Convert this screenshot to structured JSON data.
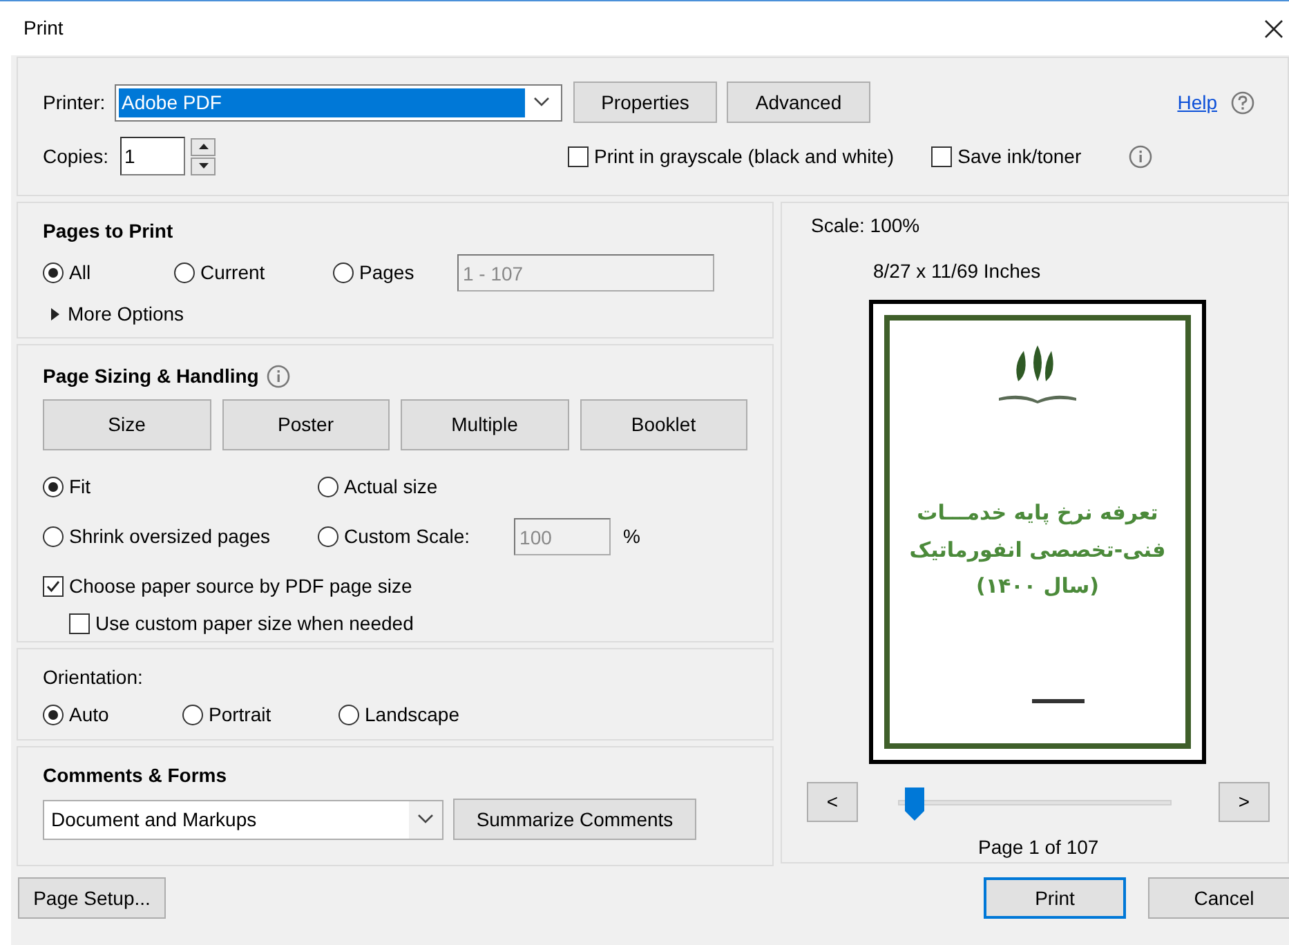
{
  "window": {
    "title": "Print"
  },
  "printer": {
    "label": "Printer:",
    "value": "Adobe PDF",
    "buttons": [
      "Properties",
      "Advanced"
    ]
  },
  "help": {
    "label": "Help"
  },
  "copies": {
    "label": "Copies:",
    "value": "1"
  },
  "top_checkboxes": [
    {
      "label": "Print in grayscale (black and white)",
      "checked": false
    },
    {
      "label": "Save ink/toner",
      "checked": false
    }
  ],
  "pages_to_print": {
    "title": "Pages to Print",
    "options": [
      {
        "label": "All",
        "selected": true
      },
      {
        "label": "Current",
        "selected": false
      },
      {
        "label": "Pages",
        "selected": false
      }
    ],
    "range": {
      "value": "1 - 107"
    },
    "more_options": "More Options"
  },
  "page_sizing": {
    "title": "Page Sizing & Handling",
    "modes": [
      "Size",
      "Poster",
      "Multiple",
      "Booklet"
    ],
    "options": [
      {
        "label": "Fit",
        "selected": true
      },
      {
        "label": "Actual size",
        "selected": false
      },
      {
        "label": "Shrink oversized pages",
        "selected": false
      },
      {
        "label": "Custom Scale:",
        "selected": false
      }
    ],
    "custom_scale": {
      "value": "100",
      "unit": "%"
    },
    "checkboxes": [
      {
        "label": "Choose paper source by PDF page size",
        "checked": true,
        "children": [
          {
            "label": "Use custom paper size when needed",
            "checked": false
          }
        ]
      }
    ]
  },
  "orientation": {
    "title": "Orientation:",
    "options": [
      {
        "label": "Auto",
        "selected": true
      },
      {
        "label": "Portrait",
        "selected": false
      },
      {
        "label": "Landscape",
        "selected": false
      }
    ]
  },
  "comments_forms": {
    "title": "Comments & Forms",
    "dropdown": {
      "value": "Document and Markups"
    },
    "button": "Summarize Comments"
  },
  "preview": {
    "scale": "Scale: 100%",
    "size": "8/27 x 11/69 Inches",
    "document": {
      "title_lines": [
        "تعرفه نرخ پایه خدمـــات",
        "فنی-تخصصی انفورماتیک",
        "(سال ۱۴۰۰)"
      ]
    },
    "prev": "<",
    "next": ">",
    "slider": {
      "level": 0.05
    },
    "page_label": "Page 1 of 107"
  },
  "footer": {
    "page_setup": "Page Setup...",
    "print": "Print",
    "cancel": "Cancel"
  }
}
